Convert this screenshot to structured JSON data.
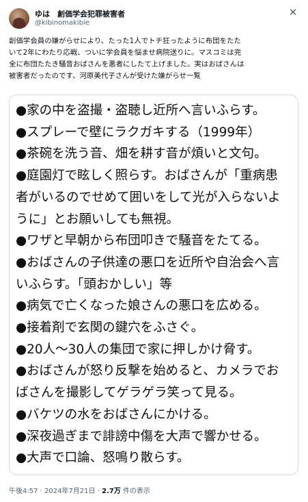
{
  "author": {
    "display_name": "ゆは　創価学会犯罪被害者",
    "handle": "@kibinomakibie"
  },
  "icons": {
    "close": "close-icon",
    "avatar": "profile-photo"
  },
  "body_lines": [
    "創価学会員の嫌がらせにより、たった1人でトチ狂ったように布団をたた",
    "いて2年にわたり応戦、ついに学会員を悩ませ病院送りに。マスコミは完",
    "全に布団たたき騒音おばさんを悪者にしたて上げました。実はおばさんは",
    "被害者だったのです、河原美代子さんが受けた嫌がらせ一覧"
  ],
  "image_lines": [
    "●家の中を盗撮・盗聴し近所へ言いふらす。",
    "●スプレーで壁にラクガキする（1999年）",
    "●茶碗を洗う音、畑を耕す音が煩いと文句。",
    "●庭園灯で眩しく照らす。おばさんが「重病患",
    "者がいるのでせめて囲いをして光が入らないよ",
    "うに」とお願いしても無視。",
    "●ワザと早朝から布団叩きで騒音をたてる。",
    "●おばさんの子供達の悪口を近所や自治会へ言",
    "いふらす。「頭おかしい」等",
    "●病気で亡くなった娘さんの悪口を広める。",
    "●接着剤で玄関の鍵穴をふさぐ。",
    "●20人〜30人の集団で家に押しかけ脅す。",
    "●おばさんが怒り反撃を始めると、カメラでお",
    "ばさんを撮影してゲラゲラ笑って見る。",
    "●バケツの水をおばさんにかける。",
    "●深夜過ぎまで誹謗中傷を大声で響かせる。",
    "●大声で口論、怒鳴り散らす。"
  ],
  "footer": {
    "time": "午後4:57",
    "separator": " · ",
    "date": "2024年7月21日",
    "views_count": "2.7万",
    "views_label": " 件の表示"
  }
}
